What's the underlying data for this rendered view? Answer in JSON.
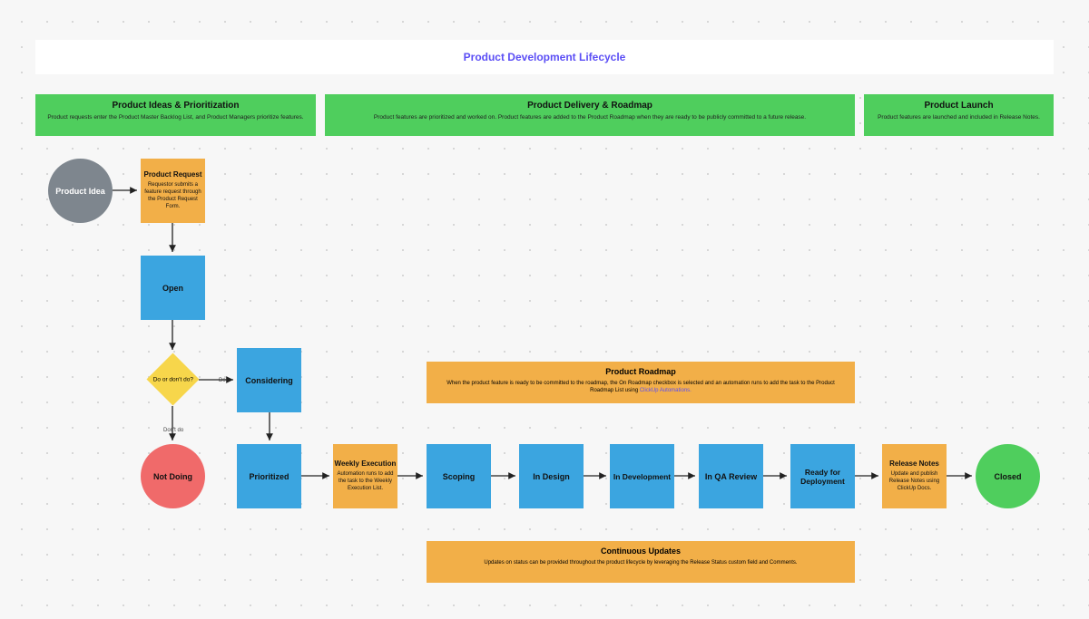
{
  "title": "Product Development Lifecycle",
  "lanes": {
    "ideas": {
      "title": "Product Ideas & Prioritization",
      "sub": "Product requests enter the Product Master Backlog List, and Product Managers prioritize features."
    },
    "delivery": {
      "title": "Product Delivery & Roadmap",
      "sub": "Product features are prioritized and worked on. Product features are added to the Product Roadmap when they are ready to be publicly committed to a future release."
    },
    "launch": {
      "title": "Product Launch",
      "sub": "Product features are launched and included in Release Notes."
    }
  },
  "nodes": {
    "idea": "Product Idea",
    "request": {
      "t": "Product Request",
      "d": "Requestor submits a feature request through the Product Request Form."
    },
    "open": "Open",
    "decision": "Do or don't do?",
    "considering": "Considering",
    "notdoing": "Not Doing",
    "prioritized": "Prioritized",
    "weekly": {
      "t": "Weekly Execution",
      "d": "Automation runs to add the task to the Weekly Execution List."
    },
    "scoping": "Scoping",
    "indesign": "In Design",
    "indev": "In Development",
    "inqa": "In QA Review",
    "ready": "Ready for Deployment",
    "relnotes": {
      "t": "Release Notes",
      "d": "Update and publish Release Notes using ClickUp Docs."
    },
    "closed": "Closed"
  },
  "banners": {
    "roadmap": {
      "t": "Product Roadmap",
      "d": "When the product feature is ready to be committed to the roadmap, the On Roadmap checkbox is selected and an automation runs to add the task to the Product Roadmap List using ",
      "link": "ClickUp Automations."
    },
    "updates": {
      "t": "Continuous Updates",
      "d": "Updates on status can be provided throughout the product lifecycle by leveraging the Release Status custom field and Comments."
    }
  },
  "labels": {
    "do": "Do",
    "dontdo": "Don't do"
  }
}
